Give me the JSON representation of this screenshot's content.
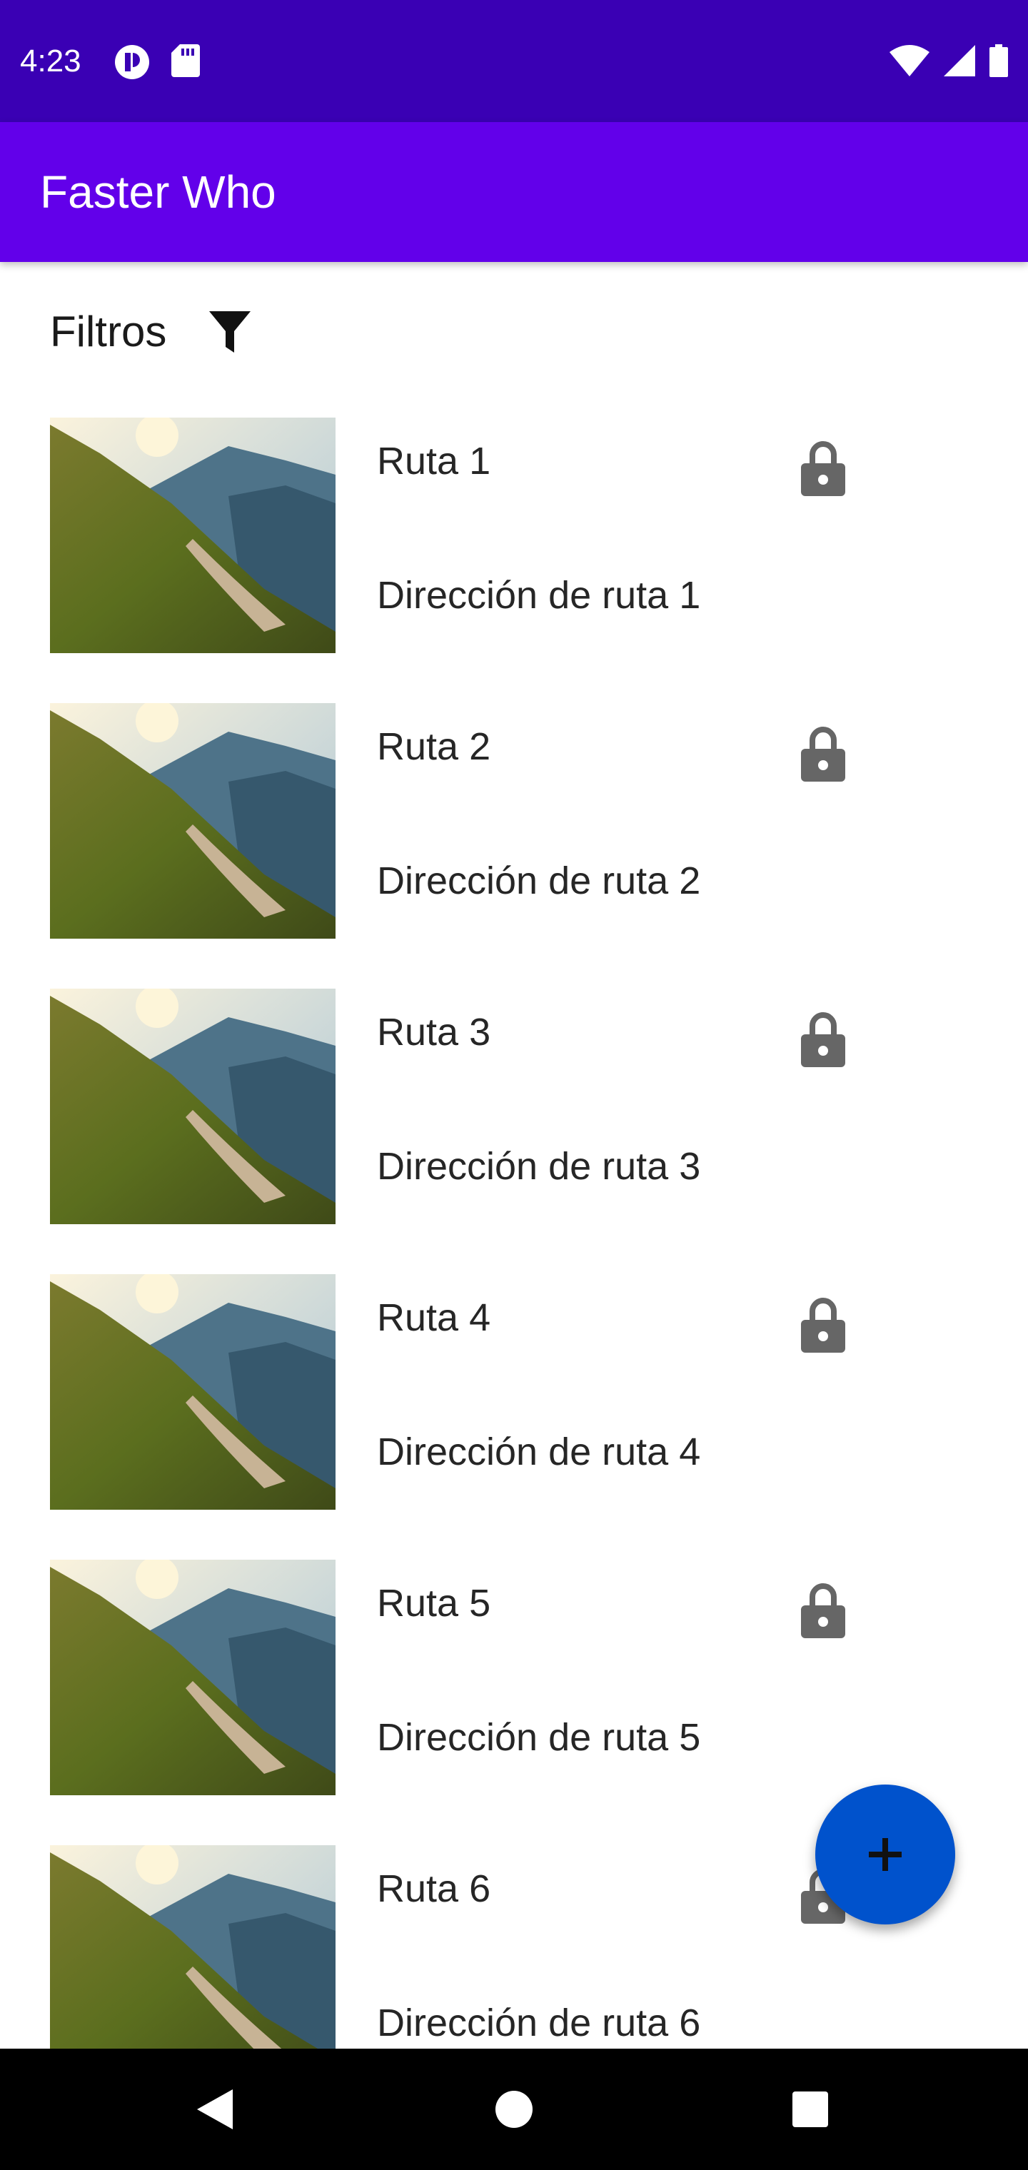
{
  "status_bar": {
    "time": "4:23",
    "left_icons": [
      "app-notification-icon",
      "sd-card-icon"
    ],
    "right_icons": [
      "wifi-icon",
      "cell-signal-icon",
      "battery-icon"
    ]
  },
  "app_bar": {
    "title": "Faster Who",
    "background": "#6200ea"
  },
  "filter": {
    "label": "Filtros",
    "icon": "filter-icon"
  },
  "routes": [
    {
      "title": "Ruta 1",
      "address": "Dirección de ruta 1",
      "icon": "lock-icon"
    },
    {
      "title": "Ruta 2",
      "address": "Dirección de ruta 2",
      "icon": "lock-icon"
    },
    {
      "title": "Ruta 3",
      "address": "Dirección de ruta 3",
      "icon": "lock-icon"
    },
    {
      "title": "Ruta 4",
      "address": "Dirección de ruta 4",
      "icon": "lock-icon"
    },
    {
      "title": "Ruta 5",
      "address": "Dirección de ruta 5",
      "icon": "lock-icon"
    },
    {
      "title": "Ruta 6",
      "address": "Dirección de ruta 6",
      "icon": "lock-icon"
    }
  ],
  "fab": {
    "icon": "plus-icon",
    "color": "#0052cc"
  },
  "nav_bar": {
    "buttons": [
      "back-icon",
      "home-icon",
      "recents-icon"
    ]
  }
}
